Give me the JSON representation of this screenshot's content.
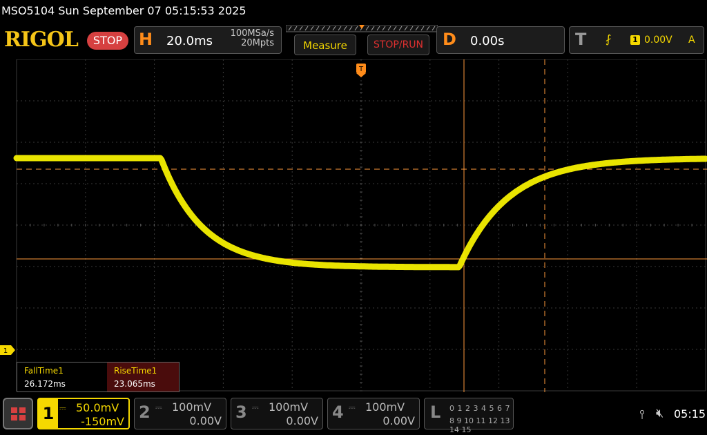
{
  "title_bar": {
    "text": "MSO5104  Sun September 07 05:15:53 2025"
  },
  "toolbar": {
    "logo": "RIGOL",
    "run_state": "STOP",
    "horizontal": {
      "letter": "H",
      "timebase": "20.0ms",
      "sample_rate": "100MSa/s",
      "memory_depth": "20Mpts"
    },
    "measure_label": "Measure",
    "stop_run_label": "STOP/RUN",
    "delay": {
      "letter": "D",
      "value": "0.00s"
    },
    "trigger": {
      "letter": "T",
      "edge_icon": "rising-edge-icon",
      "source": "1",
      "level": "0.00V",
      "mode": "A"
    }
  },
  "screen": {
    "ch1_marker": "1",
    "trace_color": "#f5f000",
    "cursor_color": "#ff9a3c"
  },
  "measurements": [
    {
      "name": "FallTime1",
      "value": "26.172ms"
    },
    {
      "name": "RiseTime1",
      "value": "23.065ms"
    }
  ],
  "channels": [
    {
      "num": "1",
      "scale": "50.0mV",
      "offset": "-150mV",
      "active": true
    },
    {
      "num": "2",
      "scale": "100mV",
      "offset": "0.00V",
      "active": false
    },
    {
      "num": "3",
      "scale": "100mV",
      "offset": "0.00V",
      "active": false
    },
    {
      "num": "4",
      "scale": "100mV",
      "offset": "0.00V",
      "active": false
    }
  ],
  "logic": {
    "letter": "L",
    "row1": "0 1 2 3  4 5 6 7",
    "row2": "8 9 10 11 12 13 14 15"
  },
  "status": {
    "clock": "05:15",
    "usb_icon": "usb-icon",
    "speaker_icon": "speaker-muted-icon"
  },
  "colors": {
    "accent": "#f5d800",
    "stop": "#d64040",
    "horizontal": "#ff8c1a"
  }
}
